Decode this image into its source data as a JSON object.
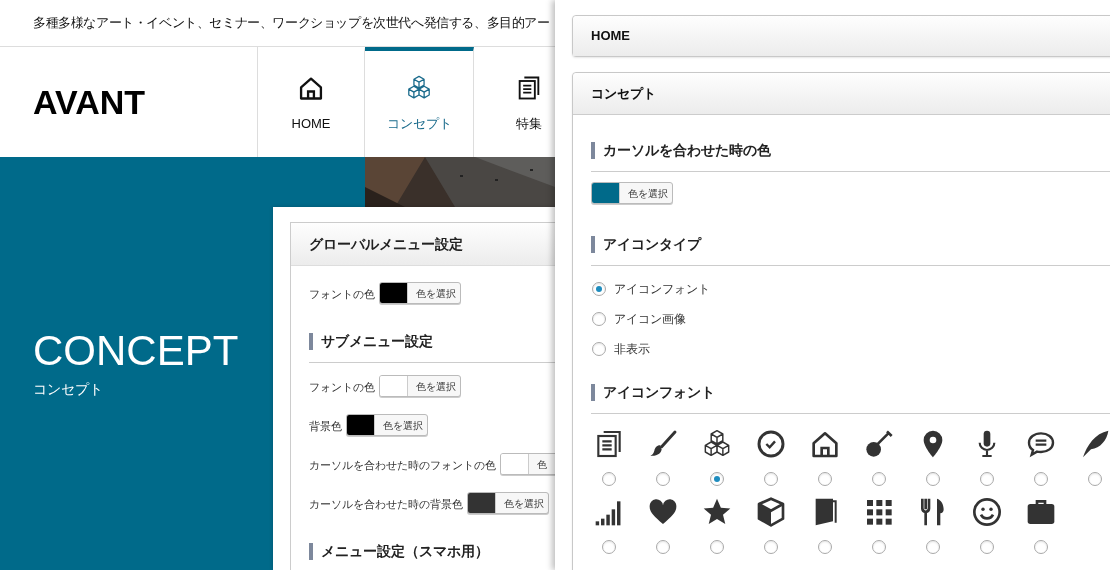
{
  "site_preview": {
    "tagline": "多種多様なアート・イベント、セミナー、ワークショップを次世代へ発信する、多目的アー",
    "logo": "AVANT",
    "nav": [
      {
        "label": "HOME",
        "selected": false
      },
      {
        "label": "コンセプト",
        "selected": true
      },
      {
        "label": "特集",
        "selected": false
      }
    ],
    "hero": {
      "title": "CONCEPT",
      "subtitle": "コンセプト"
    }
  },
  "global_menu_settings": {
    "title": "グローバルメニュー設定",
    "rows": [
      {
        "kind": "color",
        "label": "フォントの色",
        "color": "#000000",
        "button": "色を選択"
      },
      {
        "kind": "heading",
        "label": "サブメニュー設定"
      },
      {
        "kind": "color",
        "label": "フォントの色",
        "color": "#ffffff",
        "button": "色を選択"
      },
      {
        "kind": "color",
        "label": "背景色",
        "color": "#000000",
        "button": "色を選択"
      },
      {
        "kind": "color",
        "label": "カーソルを合わせた時のフォントの色",
        "color": "#ffffff",
        "button": "色"
      },
      {
        "kind": "color",
        "label": "カーソルを合わせた時の背景色",
        "color": "#333333",
        "button": "色を選択"
      },
      {
        "kind": "heading",
        "label": "メニュー設定（スマホ用）"
      }
    ]
  },
  "settings_panel": {
    "sections": [
      {
        "title": "HOME",
        "expanded": false
      },
      {
        "title": "コンセプト",
        "expanded": true
      }
    ],
    "hover_color": {
      "heading": "カーソルを合わせた時の色",
      "color": "#006a8a",
      "button": "色を選択"
    },
    "icon_type": {
      "heading": "アイコンタイプ",
      "options": [
        {
          "label": "アイコンフォント",
          "selected": true
        },
        {
          "label": "アイコン画像",
          "selected": false
        },
        {
          "label": "非表示",
          "selected": false
        }
      ]
    },
    "icon_font": {
      "heading": "アイコンフォント",
      "options": [
        {
          "selected": false
        },
        {
          "selected": false
        },
        {
          "selected": true
        },
        {
          "selected": false
        },
        {
          "selected": false
        },
        {
          "selected": false
        },
        {
          "selected": false
        },
        {
          "selected": false
        },
        {
          "selected": false
        },
        {
          "selected": false
        },
        {
          "selected": false
        },
        {
          "selected": false
        },
        {
          "selected": false
        },
        {
          "selected": false
        },
        {
          "selected": false
        },
        {
          "selected": false
        },
        {
          "selected": false
        },
        {
          "selected": false
        },
        {
          "selected": false
        }
      ]
    }
  }
}
